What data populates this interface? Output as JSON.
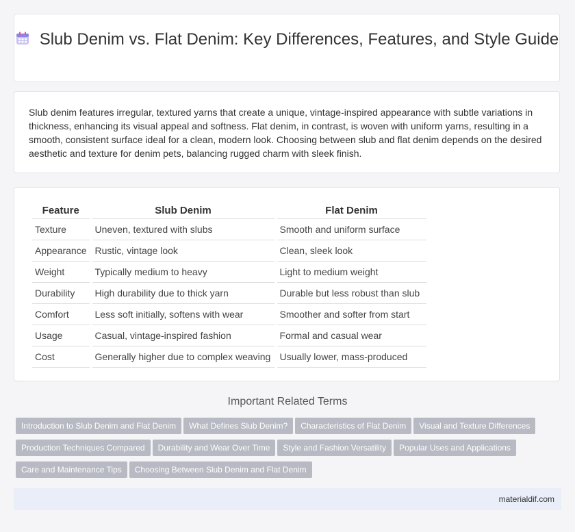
{
  "header": {
    "title": "Slub Denim vs. Flat Denim: Key Differences, Features, and Style Guide",
    "icon": "calendar-icon"
  },
  "intro": {
    "text": "Slub denim features irregular, textured yarns that create a unique, vintage-inspired appearance with subtle variations in thickness, enhancing its visual appeal and softness. Flat denim, in contrast, is woven with uniform yarns, resulting in a smooth, consistent surface ideal for a clean, modern look. Choosing between slub and flat denim depends on the desired aesthetic and texture for denim pets, balancing rugged charm with sleek finish."
  },
  "table": {
    "headers": [
      "Feature",
      "Slub Denim",
      "Flat Denim"
    ],
    "rows": [
      [
        "Texture",
        "Uneven, textured with slubs",
        "Smooth and uniform surface"
      ],
      [
        "Appearance",
        "Rustic, vintage look",
        "Clean, sleek look"
      ],
      [
        "Weight",
        "Typically medium to heavy",
        "Light to medium weight"
      ],
      [
        "Durability",
        "High durability due to thick yarn",
        "Durable but less robust than slub"
      ],
      [
        "Comfort",
        "Less soft initially, softens with wear",
        "Smoother and softer from start"
      ],
      [
        "Usage",
        "Casual, vintage-inspired fashion",
        "Formal and casual wear"
      ],
      [
        "Cost",
        "Generally higher due to complex weaving",
        "Usually lower, mass-produced"
      ]
    ]
  },
  "related": {
    "title": "Important Related Terms",
    "tags": [
      "Introduction to Slub Denim and Flat Denim",
      "What Defines Slub Denim?",
      "Characteristics of Flat Denim",
      "Visual and Texture Differences",
      "Production Techniques Compared",
      "Durability and Wear Over Time",
      "Style and Fashion Versatility",
      "Popular Uses and Applications",
      "Care and Maintenance Tips",
      "Choosing Between Slub Denim and Flat Denim"
    ]
  },
  "footer": {
    "site": "materialdif.com"
  }
}
